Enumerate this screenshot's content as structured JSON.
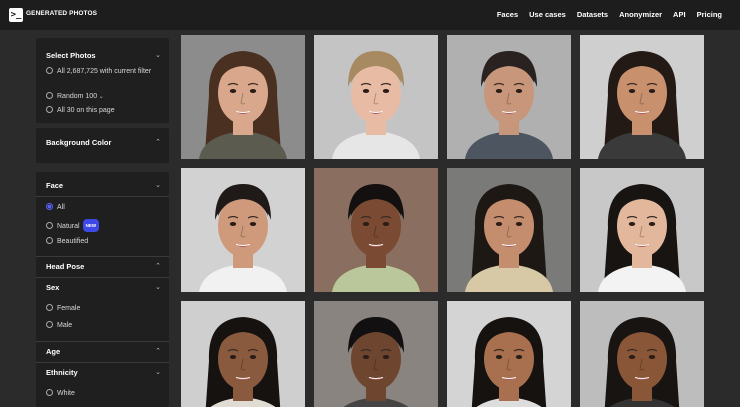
{
  "brand": {
    "name": "GENERATED PHOTOS",
    "logo_glyph": ">_"
  },
  "nav": [
    "Faces",
    "Use cases",
    "Datasets",
    "Anonymizer",
    "API",
    "Pricing"
  ],
  "sidebar": {
    "select_photos": {
      "title": "Select Photos",
      "options": [
        "All 2,687,725 with current filter",
        "Random 100",
        "All 30 on this page"
      ]
    },
    "background_color": {
      "title": "Background Color"
    },
    "face": {
      "title": "Face",
      "options": [
        "All",
        "Natural",
        "Beautified"
      ],
      "new_badge": "NEW",
      "selected": "All"
    },
    "head_pose": {
      "title": "Head Pose"
    },
    "sex": {
      "title": "Sex",
      "options": [
        "Female",
        "Male"
      ]
    },
    "age": {
      "title": "Age"
    },
    "ethnicity": {
      "title": "Ethnicity",
      "options": [
        "White"
      ]
    }
  },
  "icons": {
    "chevron_down": "chevron-down-icon",
    "chevron_up": "chevron-up-icon"
  },
  "photos": [
    {
      "bg": "#8c8c8c",
      "skin": "#d9a88c",
      "hair": "#4a3020",
      "shirt": "#5b5b4f",
      "long": true
    },
    {
      "bg": "#c4c4c4",
      "skin": "#e8bca4",
      "hair": "#a88a62",
      "shirt": "#e6e6e6",
      "long": false
    },
    {
      "bg": "#b0b0b0",
      "skin": "#c8967a",
      "hair": "#2a2220",
      "shirt": "#4d5560",
      "long": false
    },
    {
      "bg": "#cfcfcf",
      "skin": "#c9906e",
      "hair": "#231a16",
      "shirt": "#3a3a3a",
      "long": true
    },
    {
      "bg": "#d2d2d2",
      "skin": "#cf9a7c",
      "hair": "#1f1a18",
      "shirt": "#f1f1f1",
      "long": false
    },
    {
      "bg": "#8a6f60",
      "skin": "#7a4a32",
      "hair": "#141010",
      "shirt": "#b9c79a",
      "long": false
    },
    {
      "bg": "#7a7a78",
      "skin": "#c48e6e",
      "hair": "#1e1814",
      "shirt": "#d8c9a6",
      "long": true
    },
    {
      "bg": "#c8c8c8",
      "skin": "#e3b79c",
      "hair": "#171412",
      "shirt": "#f3f3f3",
      "long": true
    },
    {
      "bg": "#cfcfcf",
      "skin": "#8a5a3e",
      "hair": "#161210",
      "shirt": "#e0dcd4",
      "long": true
    },
    {
      "bg": "#8a8480",
      "skin": "#6e4630",
      "hair": "#121010",
      "shirt": "#444",
      "long": false
    },
    {
      "bg": "#d4d4d4",
      "skin": "#a8704e",
      "hair": "#161210",
      "shirt": "#ddd",
      "long": true
    },
    {
      "bg": "#bdbdbd",
      "skin": "#8a5638",
      "hair": "#181412",
      "shirt": "#333",
      "long": true
    }
  ]
}
